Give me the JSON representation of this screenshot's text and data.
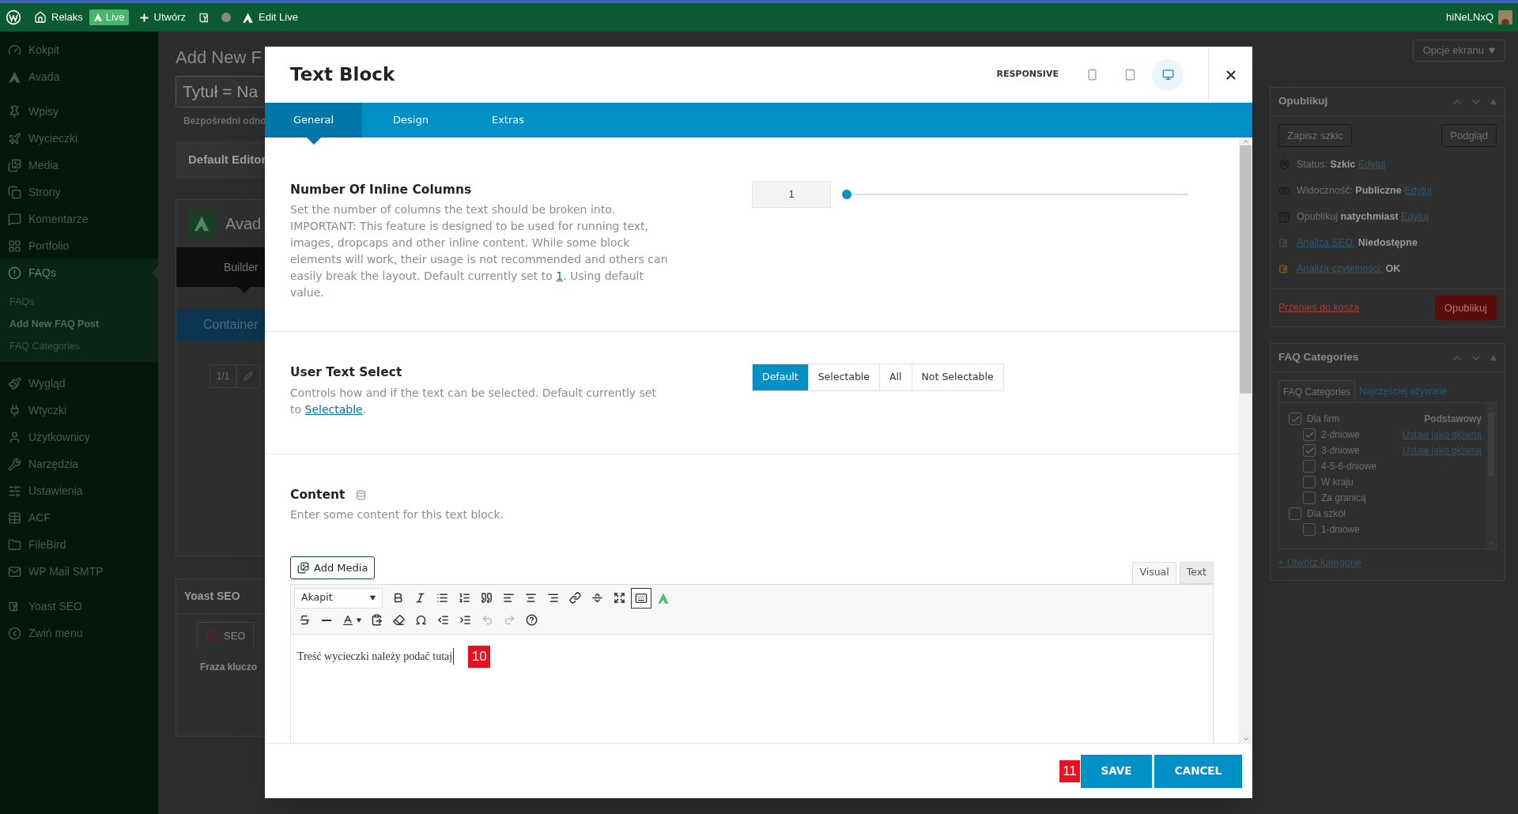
{
  "admin_bar": {
    "site": "Relaks",
    "live": "Live",
    "create": "Utwórz",
    "edit_live": "Edit Live",
    "user": "hiNeLNxQ"
  },
  "sidebar": {
    "groups": [
      [
        {
          "label": "Kokpit",
          "selected": false
        },
        {
          "label": "Avada",
          "selected": false
        }
      ],
      [
        {
          "label": "Wpisy",
          "selected": false
        },
        {
          "label": "Wycieczki",
          "selected": false
        },
        {
          "label": "Media",
          "selected": false
        },
        {
          "label": "Strony",
          "selected": false
        },
        {
          "label": "Komentarze",
          "selected": false
        },
        {
          "label": "Portfolio",
          "selected": false
        },
        {
          "label": "FAQs",
          "selected": true,
          "children": [
            {
              "label": "FAQs",
              "selected": false
            },
            {
              "label": "Add New FAQ Post",
              "selected": true
            },
            {
              "label": "FAQ Categories",
              "selected": false
            }
          ]
        }
      ],
      [
        {
          "label": "Wygląd",
          "selected": false
        },
        {
          "label": "Wtyczki",
          "selected": false
        },
        {
          "label": "Użytkownicy",
          "selected": false
        },
        {
          "label": "Narzędzia",
          "selected": false
        },
        {
          "label": "Ustawienia",
          "selected": false
        },
        {
          "label": "ACF",
          "selected": false
        },
        {
          "label": "FileBird",
          "selected": false
        },
        {
          "label": "WP Mail SMTP",
          "selected": false
        }
      ],
      [
        {
          "label": "Yoast SEO",
          "selected": false
        },
        {
          "label": "Zwiń menu",
          "selected": false
        }
      ]
    ]
  },
  "editor_page": {
    "heading": "Add New F",
    "title_field": "Tytuł = Na",
    "permalink": "Bezpośredni odno",
    "default_editor": "Default Editor",
    "builder_title": "Avad",
    "builder_tab": "Builder",
    "container": "Container",
    "column": "1/1",
    "yoast": {
      "title": "Yoast SEO",
      "tab": "SEO",
      "focus_label": "Fraza kluczo"
    }
  },
  "screen_options": "Opcje ekranu",
  "publish": {
    "title": "Opublikuj",
    "save_draft": "Zapisz szkic",
    "preview": "Podgląd",
    "rows": [
      {
        "label": "Status:",
        "value": "Szkic",
        "link": "Edytuj"
      },
      {
        "label": "Widoczność:",
        "value": "Publiczne",
        "link": "Edytuj"
      },
      {
        "label": "Opublikuj",
        "value": "natychmiast",
        "link": "Edytuj"
      },
      {
        "label": "Analiza SEO:",
        "value": "Niedostępne"
      },
      {
        "label": "Analiza czytelności:",
        "value": "OK"
      }
    ],
    "trash": "Przenieś do kosza",
    "publish_button": "Opublikuj"
  },
  "faq_categories": {
    "title": "FAQ Categories",
    "tabs": [
      {
        "label": "FAQ Categories",
        "selected": true
      },
      {
        "label": "Najczęściej używane",
        "selected": false
      }
    ],
    "primary_label": "Podstawowy",
    "items": [
      {
        "label": "Dla firm",
        "checked": true,
        "children": [
          {
            "label": "2-dniowe",
            "checked": true,
            "link": "Ustaw jako główną"
          },
          {
            "label": "3-dniowe",
            "checked": true,
            "link": "Ustaw jako główną"
          },
          {
            "label": "4-5-6-dniowe",
            "checked": false
          },
          {
            "label": "W kraju",
            "checked": false
          },
          {
            "label": "Za granicą",
            "checked": false
          }
        ]
      },
      {
        "label": "Dla szkół",
        "checked": false,
        "children": [
          {
            "label": "1-dniowe",
            "checked": false
          }
        ]
      }
    ],
    "add_link": "+ Utwórz kategorię"
  },
  "modal": {
    "title": "Text Block",
    "responsive": "RESPONSIVE",
    "devices": [
      {
        "selected": false
      },
      {
        "selected": false
      },
      {
        "selected": true
      }
    ],
    "tabs": [
      {
        "label": "General",
        "selected": true
      },
      {
        "label": "Design",
        "selected": false
      },
      {
        "label": "Extras",
        "selected": false
      }
    ],
    "columns": {
      "label": "Number Of Inline Columns",
      "description": "Set the number of columns the text should be broken into. IMPORTANT: This feature is designed to be used for running text, images, dropcaps and other inline content. While some block elements will work, their usage is not recommended and others can easily break the layout. Default currently set to",
      "default_link": "1",
      "description_end": ". Using default value.",
      "value": "1",
      "level": 0
    },
    "text_select": {
      "label": "User Text Select",
      "description": "Controls how and if the text can be selected. Default currently set to",
      "default_link": "Selectable",
      "description_end": ".",
      "options": [
        {
          "label": "Default",
          "selected": true
        },
        {
          "label": "Selectable",
          "selected": false
        },
        {
          "label": "All",
          "selected": false
        },
        {
          "label": "Not Selectable",
          "selected": false
        }
      ]
    },
    "content": {
      "label": "Content",
      "description": "Enter some content for this text block.",
      "add_media": "Add Media",
      "editor_tabs": [
        {
          "label": "Visual",
          "selected": true
        },
        {
          "label": "Text",
          "selected": false
        }
      ],
      "format": "Akapit",
      "text": "Treść wycieczki należy podać tutaj"
    },
    "save": "SAVE",
    "cancel": "CANCEL"
  },
  "markers": [
    "10",
    "11"
  ]
}
